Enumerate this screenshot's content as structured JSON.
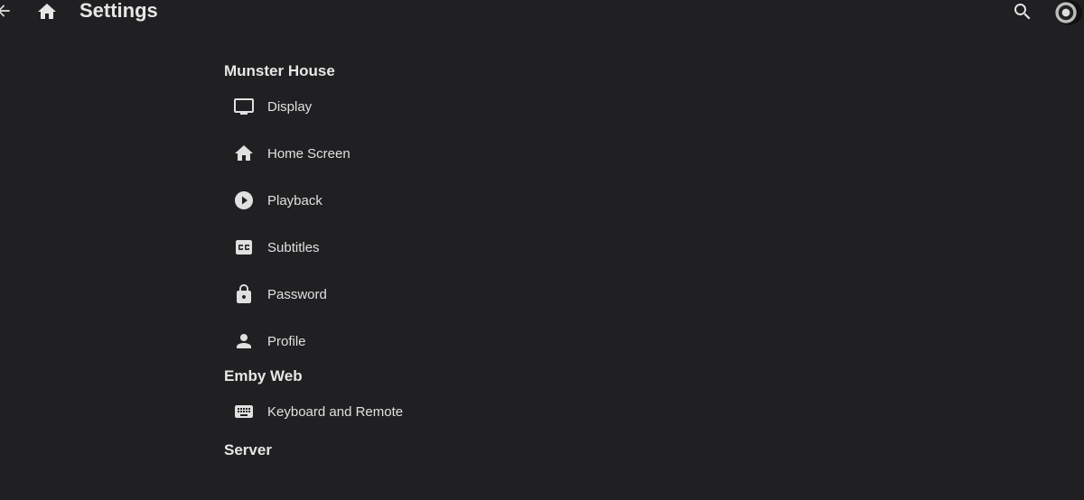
{
  "header": {
    "title": "Settings",
    "back_icon": "arrow-back-icon",
    "home_icon": "home-icon",
    "search_icon": "search-icon",
    "avatar": "user-avatar"
  },
  "sections": [
    {
      "title": "Munster House",
      "items": [
        {
          "label": "Display",
          "icon": "monitor-icon"
        },
        {
          "label": "Home Screen",
          "icon": "home-icon"
        },
        {
          "label": "Playback",
          "icon": "play-circle-icon"
        },
        {
          "label": "Subtitles",
          "icon": "closed-caption-icon"
        },
        {
          "label": "Password",
          "icon": "lock-icon"
        },
        {
          "label": "Profile",
          "icon": "person-icon"
        }
      ]
    },
    {
      "title": "Emby Web",
      "items": [
        {
          "label": "Keyboard and Remote",
          "icon": "keyboard-icon"
        }
      ]
    },
    {
      "title": "Server",
      "items": []
    }
  ]
}
